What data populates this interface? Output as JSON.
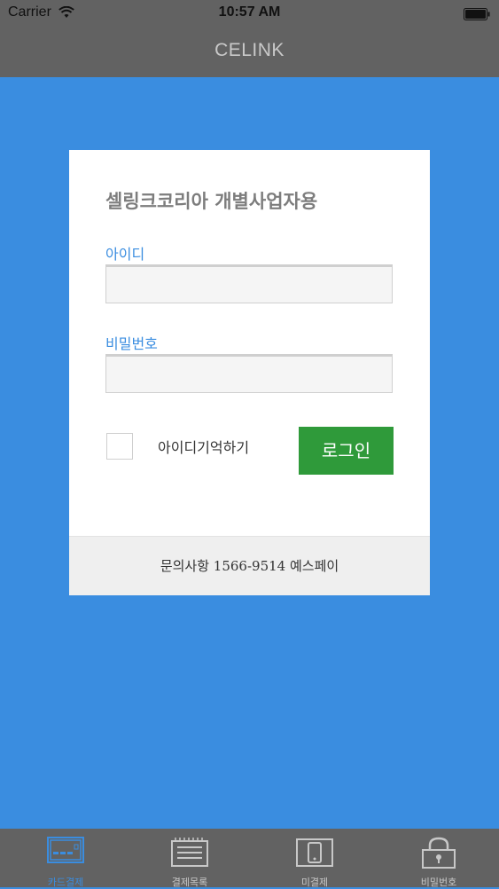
{
  "status_bar": {
    "carrier": "Carrier",
    "time": "10:57 AM"
  },
  "nav": {
    "title": "CELINK"
  },
  "login_card": {
    "heading": "셀링크코리아 개별사업자용",
    "id_label": "아이디",
    "id_value": "",
    "password_label": "비밀번호",
    "password_value": "",
    "remember_label": "아이디기억하기",
    "remember_checked": false,
    "login_button": "로그인",
    "contact": "문의사항 1566-9514 예스페이"
  },
  "tabs": [
    {
      "label": "카드결제",
      "icon": "credit-card-icon",
      "active": true
    },
    {
      "label": "결제목록",
      "icon": "list-icon",
      "active": false
    },
    {
      "label": "미결제",
      "icon": "phone-icon",
      "active": false
    },
    {
      "label": "비밀번호",
      "icon": "lock-icon",
      "active": false
    }
  ],
  "colors": {
    "background": "#3a8de0",
    "bars": "#626262",
    "login_button": "#2f9a3a",
    "accent": "#3a8de0"
  }
}
